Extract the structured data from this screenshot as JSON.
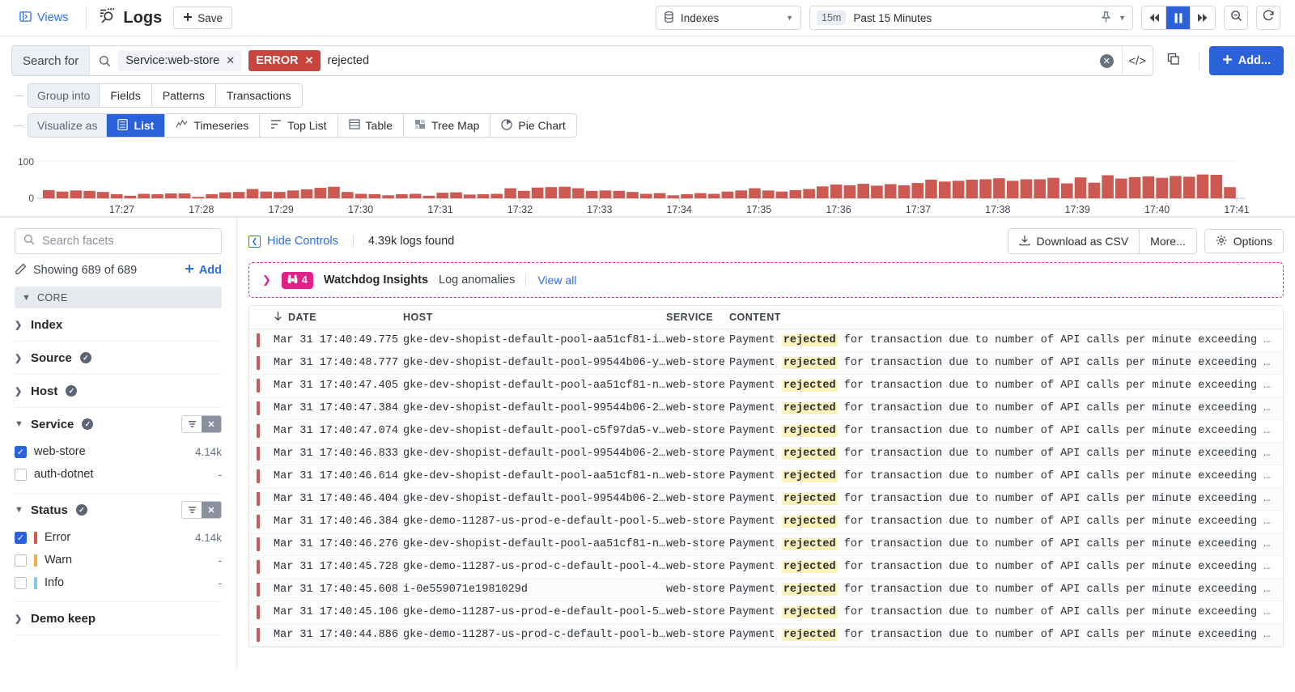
{
  "topbar": {
    "views_label": "Views",
    "views_icon": "panel-left-icon",
    "title": "Logs",
    "title_icon": "logs-search-icon",
    "save_label": "Save",
    "save_icon": "plus-icon",
    "index_label": "Indexes",
    "index_icon": "database-icon",
    "time_chip": "15m",
    "time_label": "Past 15 Minutes",
    "pin_icon": "pin-icon",
    "prev_icon": "rewind-icon",
    "pause_icon": "pause-icon",
    "next_icon": "fast-forward-icon",
    "zoomout_icon": "zoom-out-icon",
    "refresh_icon": "refresh-icon"
  },
  "search": {
    "label": "Search for",
    "search_icon": "search-icon",
    "chips": [
      {
        "text": "Service:web-store",
        "style": "plain"
      },
      {
        "text": "ERROR",
        "style": "error"
      }
    ],
    "query_text": "rejected",
    "clear_icon": "clear-circle-icon",
    "code_icon": "code-brackets-icon",
    "copy_icon": "copy-icon",
    "add_label": "Add...",
    "add_icon": "plus-icon"
  },
  "controls": {
    "group_label": "Group into",
    "group_items": [
      "Fields",
      "Patterns",
      "Transactions"
    ],
    "group_active": "",
    "visualize_label": "Visualize as",
    "visualize_items": [
      {
        "label": "List",
        "icon": "list-icon"
      },
      {
        "label": "Timeseries",
        "icon": "timeseries-icon"
      },
      {
        "label": "Top List",
        "icon": "top-list-icon"
      },
      {
        "label": "Table",
        "icon": "table-icon"
      },
      {
        "label": "Tree Map",
        "icon": "tree-map-icon"
      },
      {
        "label": "Pie Chart",
        "icon": "pie-chart-icon"
      }
    ],
    "visualize_active": "List"
  },
  "chart_data": {
    "type": "bar",
    "title": "",
    "xlabel": "",
    "ylabel": "",
    "ylim": [
      0,
      100
    ],
    "ytick_labels": [
      "0",
      "100"
    ],
    "grid": true,
    "legend": "none",
    "bar_color": "#cd5a52",
    "xtick_labels": [
      "17:27",
      "17:28",
      "17:29",
      "17:30",
      "17:31",
      "17:32",
      "17:33",
      "17:34",
      "17:35",
      "17:36",
      "17:37",
      "17:38",
      "17:39",
      "17:40",
      "17:41"
    ],
    "x_start": "17:26",
    "x_end": "17:41",
    "values": [
      22,
      18,
      21,
      20,
      17,
      11,
      7,
      12,
      11,
      13,
      13,
      4,
      11,
      16,
      17,
      25,
      18,
      17,
      21,
      24,
      28,
      31,
      17,
      12,
      11,
      8,
      11,
      12,
      7,
      15,
      16,
      10,
      11,
      12,
      27,
      20,
      29,
      30,
      31,
      27,
      20,
      21,
      20,
      17,
      12,
      14,
      8,
      11,
      14,
      12,
      18,
      21,
      27,
      21,
      18,
      22,
      25,
      32,
      37,
      35,
      39,
      34,
      38,
      35,
      41,
      50,
      45,
      47,
      50,
      51,
      54,
      47,
      51,
      51,
      55,
      40,
      56,
      42,
      62,
      53,
      57,
      59,
      55,
      60,
      58,
      64,
      63,
      30
    ]
  },
  "facets": {
    "search_placeholder": "Search facets",
    "search_icon": "search-icon",
    "showing_text": "Showing 689 of 689",
    "edit_icon": "pencil-icon",
    "add_label": "Add",
    "add_icon": "plus-icon",
    "core_label": "CORE",
    "groups": [
      {
        "name": "Index",
        "expanded": false,
        "verified": false,
        "actions": false,
        "items": []
      },
      {
        "name": "Source",
        "expanded": false,
        "verified": true,
        "actions": false,
        "items": []
      },
      {
        "name": "Host",
        "expanded": false,
        "verified": true,
        "actions": false,
        "items": []
      },
      {
        "name": "Service",
        "expanded": true,
        "verified": true,
        "actions": true,
        "items": [
          {
            "label": "web-store",
            "count": "4.14k",
            "checked": true,
            "color": ""
          },
          {
            "label": "auth-dotnet",
            "count": "-",
            "checked": false,
            "color": ""
          }
        ]
      },
      {
        "name": "Status",
        "expanded": true,
        "verified": true,
        "actions": true,
        "items": [
          {
            "label": "Error",
            "count": "4.14k",
            "checked": true,
            "color": "#d9534f"
          },
          {
            "label": "Warn",
            "count": "-",
            "checked": false,
            "color": "#eeb04e"
          },
          {
            "label": "Info",
            "count": "-",
            "checked": false,
            "color": "#84c6e7"
          }
        ]
      },
      {
        "name": "Demo keep",
        "expanded": false,
        "verified": false,
        "actions": false,
        "items": []
      }
    ],
    "filter_icon": "filter-icon",
    "clear_icon": "close-icon"
  },
  "main": {
    "hide_controls_label": "Hide Controls",
    "hide_controls_icon": "collapse-left-icon",
    "logs_found": "4.39k logs found",
    "download_label": "Download as CSV",
    "download_icon": "download-icon",
    "more_label": "More...",
    "options_label": "Options",
    "options_icon": "gear-icon"
  },
  "watchdog": {
    "chevron_icon": "chevron-right-icon",
    "badge_icon": "binoculars-icon",
    "badge_count": "4",
    "title": "Watchdog Insights",
    "subtitle": "Log anomalies",
    "link": "View all",
    "accent": "#e0218a"
  },
  "table": {
    "sort_icon": "arrow-down-icon",
    "headers": [
      "DATE",
      "HOST",
      "SERVICE",
      "CONTENT"
    ],
    "rows": [
      {
        "date": "Mar 31 17:40:49.775",
        "host": "gke-dev-shopist-default-pool-aa51cf81-i…",
        "service": "web-store",
        "pre": "Payment",
        "hl": "rejected",
        "post": "for transaction due to number of API calls per minute exceeding"
      },
      {
        "date": "Mar 31 17:40:48.777",
        "host": "gke-dev-shopist-default-pool-99544b06-y…",
        "service": "web-store",
        "pre": "Payment",
        "hl": "rejected",
        "post": "for transaction due to number of API calls per minute exceeding"
      },
      {
        "date": "Mar 31 17:40:47.405",
        "host": "gke-dev-shopist-default-pool-aa51cf81-n…",
        "service": "web-store",
        "pre": "Payment",
        "hl": "rejected",
        "post": "for transaction due to number of API calls per minute exceeding"
      },
      {
        "date": "Mar 31 17:40:47.384",
        "host": "gke-dev-shopist-default-pool-99544b06-2…",
        "service": "web-store",
        "pre": "Payment",
        "hl": "rejected",
        "post": "for transaction due to number of API calls per minute exceeding"
      },
      {
        "date": "Mar 31 17:40:47.074",
        "host": "gke-dev-shopist-default-pool-c5f97da5-v…",
        "service": "web-store",
        "pre": "Payment",
        "hl": "rejected",
        "post": "for transaction due to number of API calls per minute exceeding"
      },
      {
        "date": "Mar 31 17:40:46.833",
        "host": "gke-dev-shopist-default-pool-99544b06-2…",
        "service": "web-store",
        "pre": "Payment",
        "hl": "rejected",
        "post": "for transaction due to number of API calls per minute exceeding"
      },
      {
        "date": "Mar 31 17:40:46.614",
        "host": "gke-dev-shopist-default-pool-aa51cf81-n…",
        "service": "web-store",
        "pre": "Payment",
        "hl": "rejected",
        "post": "for transaction due to number of API calls per minute exceeding"
      },
      {
        "date": "Mar 31 17:40:46.404",
        "host": "gke-dev-shopist-default-pool-99544b06-2…",
        "service": "web-store",
        "pre": "Payment",
        "hl": "rejected",
        "post": "for transaction due to number of API calls per minute exceeding"
      },
      {
        "date": "Mar 31 17:40:46.384",
        "host": "gke-demo-11287-us-prod-e-default-pool-5…",
        "service": "web-store",
        "pre": "Payment",
        "hl": "rejected",
        "post": "for transaction due to number of API calls per minute exceeding"
      },
      {
        "date": "Mar 31 17:40:46.276",
        "host": "gke-dev-shopist-default-pool-aa51cf81-n…",
        "service": "web-store",
        "pre": "Payment",
        "hl": "rejected",
        "post": "for transaction due to number of API calls per minute exceeding"
      },
      {
        "date": "Mar 31 17:40:45.728",
        "host": "gke-demo-11287-us-prod-c-default-pool-4…",
        "service": "web-store",
        "pre": "Payment",
        "hl": "rejected",
        "post": "for transaction due to number of API calls per minute exceeding"
      },
      {
        "date": "Mar 31 17:40:45.608",
        "host": "i-0e559071e1981029d",
        "service": "web-store",
        "pre": "Payment",
        "hl": "rejected",
        "post": "for transaction due to number of API calls per minute exceeding"
      },
      {
        "date": "Mar 31 17:40:45.106",
        "host": "gke-demo-11287-us-prod-e-default-pool-5…",
        "service": "web-store",
        "pre": "Payment",
        "hl": "rejected",
        "post": "for transaction due to number of API calls per minute exceeding"
      },
      {
        "date": "Mar 31 17:40:44.886",
        "host": "gke-demo-11287-us-prod-c-default-pool-b…",
        "service": "web-store",
        "pre": "Payment",
        "hl": "rejected",
        "post": "for transaction due to number of API calls per minute exceeding"
      }
    ],
    "truncation": "…"
  }
}
